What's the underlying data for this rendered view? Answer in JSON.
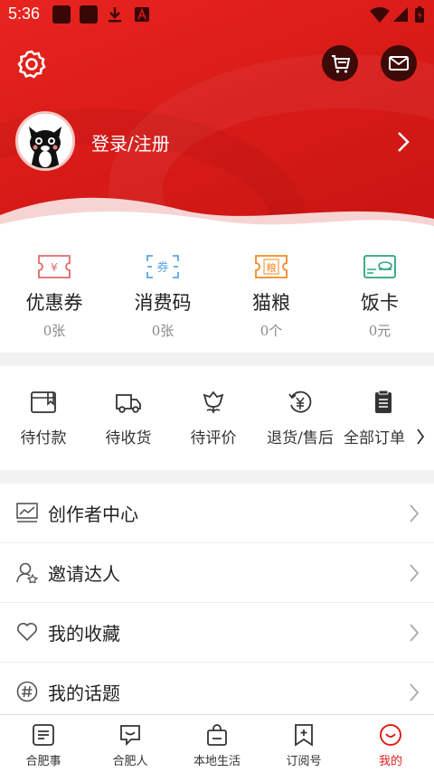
{
  "status_bar": {
    "time": "5:36"
  },
  "user": {
    "login_label": "登录/注册"
  },
  "wallet": [
    {
      "label": "优惠券",
      "value": "0张",
      "icon": "coupon-icon",
      "color": "#e06a6a"
    },
    {
      "label": "消费码",
      "value": "0张",
      "icon": "voucher-code-icon",
      "color": "#5aa6e6"
    },
    {
      "label": "猫粮",
      "value": "0个",
      "icon": "cat-food-icon",
      "color": "#f08a24",
      "icon_text": "粮"
    },
    {
      "label": "饭卡",
      "value": "0元",
      "icon": "meal-card-icon",
      "color": "#2aa57a"
    }
  ],
  "coupon_icon_text": "¥",
  "voucher_icon_text": "券",
  "orders": [
    {
      "label": "待付款",
      "icon": "wallet-icon"
    },
    {
      "label": "待收货",
      "icon": "truck-icon"
    },
    {
      "label": "待评价",
      "icon": "flower-icon"
    },
    {
      "label": "退货/售后",
      "icon": "refund-icon"
    },
    {
      "label": "全部订单",
      "icon": "clipboard-icon"
    }
  ],
  "menu": [
    {
      "label": "创作者中心",
      "icon": "chart-icon"
    },
    {
      "label": "邀请达人",
      "icon": "invite-user-icon"
    },
    {
      "label": "我的收藏",
      "icon": "heart-icon"
    },
    {
      "label": "我的话题",
      "icon": "hashtag-icon"
    }
  ],
  "nav": [
    {
      "label": "合肥事",
      "icon": "news-icon"
    },
    {
      "label": "合肥人",
      "icon": "chat-icon"
    },
    {
      "label": "本地生活",
      "icon": "shopping-bag-icon"
    },
    {
      "label": "订阅号",
      "icon": "subscribe-icon"
    },
    {
      "label": "我的",
      "icon": "smile-icon",
      "active": true
    }
  ],
  "colors": {
    "brand_red": "#e0201c",
    "header_red": "#d71a17"
  }
}
